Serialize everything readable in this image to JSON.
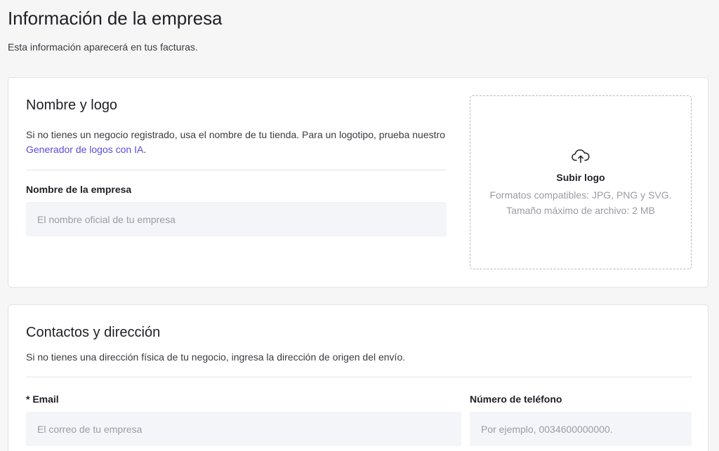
{
  "header": {
    "title": "Información de la empresa",
    "subtitle": "Esta información aparecerá en tus facturas."
  },
  "name_logo_section": {
    "title": "Nombre y logo",
    "description": "Si no tienes un negocio registrado, usa el nombre de tu tienda. Para un logotipo, prueba nuestro ",
    "link_text": "Generador de logos con IA",
    "description_end": ".",
    "company_name_label": "Nombre de la empresa",
    "company_name_value": "",
    "company_name_placeholder": "El nombre oficial de tu empresa",
    "upload": {
      "icon": "cloud-upload-icon",
      "title": "Subir logo",
      "formats": "Formatos compatibles: JPG, PNG y SVG.",
      "max_size": "Tamaño máximo de archivo: 2 MB"
    }
  },
  "contact_section": {
    "title": "Contactos y dirección",
    "description": "Si no tienes una dirección física de tu negocio, ingresa la dirección de origen del envío.",
    "email_label": "* Email",
    "email_value": "",
    "email_placeholder": "El correo de tu empresa",
    "phone_label": "Número de teléfono",
    "phone_value": "",
    "phone_placeholder": "Por ejemplo, 0034600000000."
  },
  "colors": {
    "background": "#f6f6f7",
    "card": "#ffffff",
    "link": "#5b4bdb",
    "input_bg": "#f4f5f9",
    "placeholder": "#9b9ba3"
  }
}
